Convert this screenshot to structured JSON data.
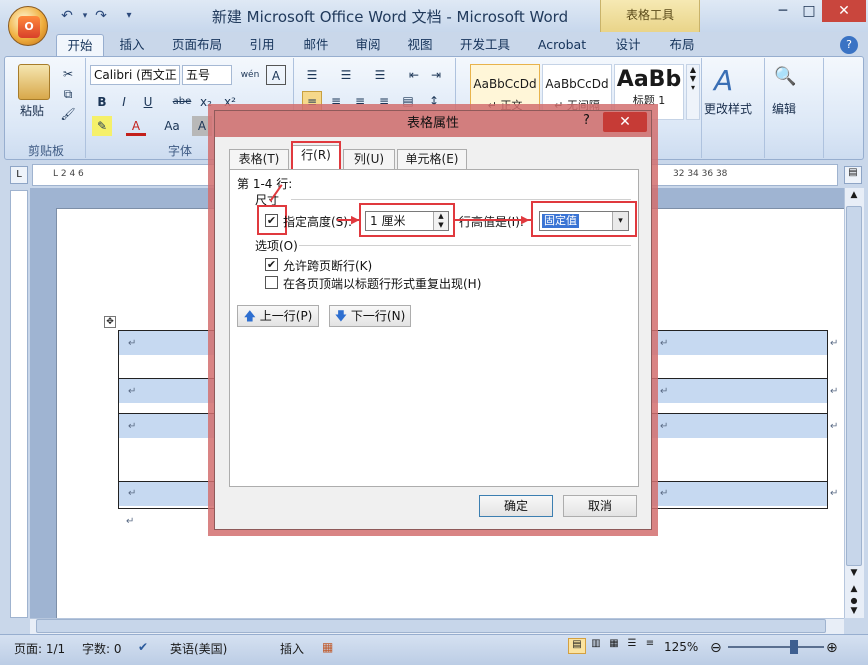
{
  "app": {
    "window_title": "新建 Microsoft Office Word 文档 - Microsoft Word",
    "context_tab_group": "表格工具",
    "office_button": "O"
  },
  "tabs": [
    "开始",
    "插入",
    "页面布局",
    "引用",
    "邮件",
    "审阅",
    "视图",
    "开发工具",
    "Acrobat",
    "设计",
    "布局"
  ],
  "ribbon": {
    "clipboard": {
      "paste": "粘贴",
      "label": "剪贴板"
    },
    "font": {
      "name": "Calibri (西文正",
      "size": "五号",
      "label": "字体",
      "bold": "B",
      "italic": "I",
      "underline": "U",
      "strike": "abe",
      "sub": "x₂",
      "sup": "x²",
      "wen": "wén",
      "char_border": "A",
      "aa": "Aa",
      "char_shade": "A"
    },
    "styles": {
      "s1_preview": "AaBbCcDd",
      "s1_name": "↵ 正文",
      "s2_preview": "AaBbCcDd",
      "s2_name": "↵ 无间隔",
      "s3_preview": "AaBb",
      "s3_name": "标题 1",
      "change": "更改样式"
    },
    "editing": {
      "label": "编辑"
    }
  },
  "ruler": {
    "left_marks": "L  2  4  6",
    "right_marks": "32  34  36  38"
  },
  "document": {
    "para_mark": "↵"
  },
  "status": {
    "page": "页面: 1/1",
    "words": "字数: 0",
    "language": "英语(美国)",
    "insert": "插入",
    "zoom": "125%"
  },
  "dialog": {
    "title": "表格属性",
    "help": "?",
    "close": "✕",
    "tabs": [
      "表格(T)",
      "行(R)",
      "列(U)",
      "单元格(E)"
    ],
    "row_range": "第 1-4 行:",
    "size_label": "尺寸",
    "specify_height": "指定高度(S):",
    "height_value": "1 厘米",
    "height_is_label": "行高值是(I):",
    "height_is_value": "固定值",
    "options_label": "选项(O)",
    "allow_break": "允许跨页断行(K)",
    "repeat_header": "在各页顶端以标题行形式重复出现(H)",
    "prev_row": "上一行(P)",
    "next_row": "下一行(N)",
    "ok": "确定",
    "cancel": "取消"
  }
}
